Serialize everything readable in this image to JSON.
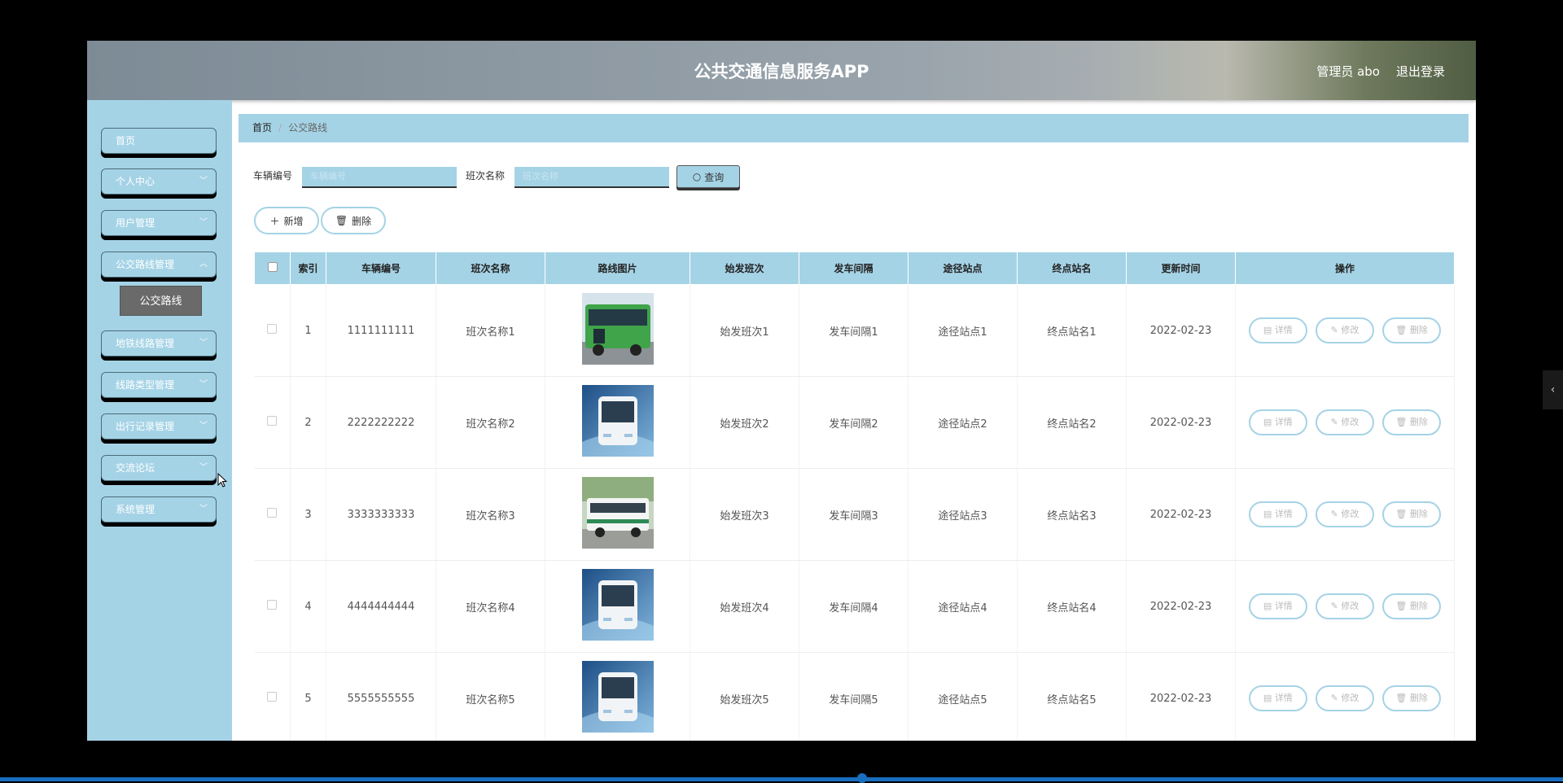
{
  "header": {
    "title": "公共交通信息服务APP",
    "user_label": "管理员 abo",
    "logout_label": "退出登录"
  },
  "sidebar": {
    "items": [
      {
        "label": "首页",
        "has_arrow": false
      },
      {
        "label": "个人中心",
        "has_arrow": true
      },
      {
        "label": "用户管理",
        "has_arrow": true
      },
      {
        "label": "公交路线管理",
        "has_arrow": true
      },
      {
        "label": "地铁线路管理",
        "has_arrow": true
      },
      {
        "label": "线路类型管理",
        "has_arrow": true
      },
      {
        "label": "出行记录管理",
        "has_arrow": true
      },
      {
        "label": "交流论坛",
        "has_arrow": true
      },
      {
        "label": "系统管理",
        "has_arrow": true
      }
    ],
    "submenu": {
      "label": "公交路线"
    }
  },
  "breadcrumb": {
    "home": "首页",
    "separator": "/",
    "current": "公交路线"
  },
  "search": {
    "vehicle_label": "车辆编号",
    "vehicle_placeholder": "车辆编号",
    "shift_label": "班次名称",
    "shift_placeholder": "班次名称",
    "query_label": "查询"
  },
  "actions": {
    "add_label": "新增",
    "delete_label": "删除"
  },
  "table": {
    "headers": [
      "索引",
      "车辆编号",
      "班次名称",
      "路线图片",
      "始发班次",
      "发车间隔",
      "途径站点",
      "终点站名",
      "更新时间",
      "操作"
    ],
    "rows": [
      {
        "index": "1",
        "vehicle": "1111111111",
        "shift": "班次名称1",
        "image": "green-bus",
        "first": "始发班次1",
        "interval": "发车间隔1",
        "via": "途径站点1",
        "terminal": "终点站名1",
        "updated": "2022-02-23"
      },
      {
        "index": "2",
        "vehicle": "2222222222",
        "shift": "班次名称2",
        "image": "blue-bus",
        "first": "始发班次2",
        "interval": "发车间隔2",
        "via": "途径站点2",
        "terminal": "终点站名2",
        "updated": "2022-02-23"
      },
      {
        "index": "3",
        "vehicle": "3333333333",
        "shift": "班次名称3",
        "image": "white-bus",
        "first": "始发班次3",
        "interval": "发车间隔3",
        "via": "途径站点3",
        "terminal": "终点站名3",
        "updated": "2022-02-23"
      },
      {
        "index": "4",
        "vehicle": "4444444444",
        "shift": "班次名称4",
        "image": "blue-bus",
        "first": "始发班次4",
        "interval": "发车间隔4",
        "via": "途径站点4",
        "terminal": "终点站名4",
        "updated": "2022-02-23"
      },
      {
        "index": "5",
        "vehicle": "5555555555",
        "shift": "班次名称5",
        "image": "blue-bus",
        "first": "始发班次5",
        "interval": "发车间隔5",
        "via": "途径站点5",
        "terminal": "终点站名5",
        "updated": "2022-02-23"
      }
    ],
    "row_actions": {
      "detail": "详情",
      "edit": "修改",
      "delete": "删除"
    }
  },
  "colors": {
    "accent": "#a5d3e6",
    "header": "#8c98a2",
    "submenu": "#6a6a6a",
    "progress": "#1a6ec0"
  },
  "playback": {
    "progress_fraction": 0.55
  }
}
